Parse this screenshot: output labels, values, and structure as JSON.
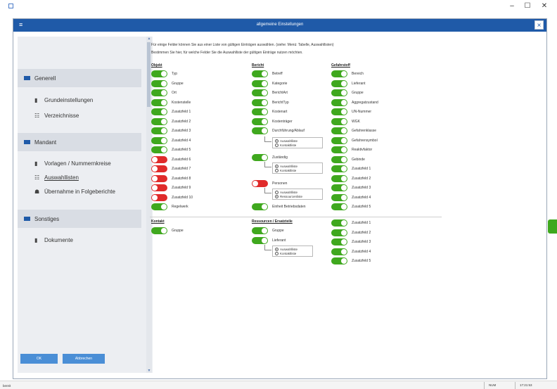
{
  "window": {
    "minimize": "–",
    "maximize": "☐",
    "close": "✕"
  },
  "dialog": {
    "title": "allgemeine Einstellungen",
    "menu_glyph": "≡",
    "close": "×"
  },
  "sidebar": {
    "groups": [
      {
        "label": "Generell",
        "items": [
          {
            "label": "Grundeinstellungen",
            "icon": "▮"
          },
          {
            "label": "Verzeichnisse",
            "icon": "☷"
          }
        ]
      },
      {
        "label": "Mandant",
        "items": [
          {
            "label": "Vorlagen / Nummernkreise",
            "icon": "▮"
          },
          {
            "label": "Auswahllisten",
            "icon": "☷"
          },
          {
            "label": "Übernahme in Folgeberichte",
            "icon": "☗"
          }
        ]
      },
      {
        "label": "Sonstiges",
        "items": [
          {
            "label": "Dokumente",
            "icon": "▮"
          }
        ]
      }
    ],
    "scroll_up": "▲",
    "scroll_down": "▼"
  },
  "buttons": {
    "ok": "OK",
    "cancel": "Abbrechen"
  },
  "intro": {
    "line1": "Für einige Felder können Sie aus einer Liste von gültigen Einträgen auswählen. (siehe: Menü: Tabelle, Auswahllisten)",
    "line2": "Bestimmen Sie hier, für welche Felder Sie die Auswahlliste der gültigen Einträge nutzen möchten."
  },
  "columns": {
    "objekt": {
      "head": "Objekt",
      "toggles": [
        {
          "label": "Typ",
          "on": true
        },
        {
          "label": "Gruppe",
          "on": true
        },
        {
          "label": "Ort",
          "on": true
        },
        {
          "label": "Kostenstelle",
          "on": true
        },
        {
          "label": "Zusatzfeld 1",
          "on": true
        },
        {
          "label": "Zusatzfeld 2",
          "on": true
        },
        {
          "label": "Zusatzfeld 3",
          "on": true
        },
        {
          "label": "Zusatzfeld 4",
          "on": true
        },
        {
          "label": "Zusatzfeld 5",
          "on": true
        },
        {
          "label": "Zusatzfeld 6",
          "on": false
        },
        {
          "label": "Zusatzfeld 7",
          "on": false
        },
        {
          "label": "Zusatzfeld 8",
          "on": false
        },
        {
          "label": "Zusatzfeld 9",
          "on": false
        },
        {
          "label": "Zusatzfeld 10",
          "on": false
        },
        {
          "label": "Regelwerk",
          "on": true
        }
      ]
    },
    "bericht": {
      "head": "Bericht",
      "toggles": [
        {
          "label": "Betreff",
          "on": true
        },
        {
          "label": "Kategorie",
          "on": true
        },
        {
          "label": "BerichtArt",
          "on": true
        },
        {
          "label": "BerichtTyp",
          "on": true
        },
        {
          "label": "Kostenart",
          "on": true
        },
        {
          "label": "Kostenträger",
          "on": true
        },
        {
          "label": "Durchführung/Ablauf",
          "on": true
        }
      ],
      "radio1": {
        "a": "Auswahlliste",
        "b": "Kontaktliste",
        "selected": "a"
      },
      "zustandig": {
        "label": "Zuständig",
        "on": true
      },
      "radio2": {
        "a": "Auswahlliste",
        "b": "Kontaktliste",
        "selected": "a"
      },
      "personen": {
        "label": "Personen",
        "on": false
      },
      "radio3": {
        "a": "Auswahlliste",
        "b": "Ressourcenliste",
        "selected": "b"
      },
      "einheit": {
        "label": "Einheit Betriebsdaten",
        "on": true
      }
    },
    "gefahrstoff": {
      "head": "Gefahrstoff",
      "toggles": [
        {
          "label": "Bereich",
          "on": true
        },
        {
          "label": "Lieferant",
          "on": true
        },
        {
          "label": "Gruppe",
          "on": true
        },
        {
          "label": "Aggregatzustand",
          "on": true
        },
        {
          "label": "UN-Nummer",
          "on": true
        },
        {
          "label": "WGK",
          "on": true
        },
        {
          "label": "Gefahrenklasse",
          "on": true
        },
        {
          "label": "Gefahrensymbol",
          "on": true
        },
        {
          "label": "Reaktivfaktor",
          "on": true
        },
        {
          "label": "Gebinde",
          "on": true
        },
        {
          "label": "Zusatzfeld 1",
          "on": true
        },
        {
          "label": "Zusatzfeld 2",
          "on": true
        },
        {
          "label": "Zusatzfeld 3",
          "on": true
        },
        {
          "label": "Zusatzfeld 4",
          "on": true
        },
        {
          "label": "Zusatzfeld 5",
          "on": true
        }
      ]
    },
    "kontakt": {
      "head": "Kontakt",
      "toggles": [
        {
          "label": "Gruppe",
          "on": true
        }
      ]
    },
    "ressourcen": {
      "head": "Ressourcen / Ersatzteile",
      "toggles": [
        {
          "label": "Gruppe",
          "on": true
        },
        {
          "label": "Lieferant",
          "on": true
        }
      ],
      "radio": {
        "a": "Auswahlliste",
        "b": "Kontaktliste",
        "selected": "a"
      }
    },
    "extra": {
      "toggles": [
        {
          "label": "Zusatzfeld 1",
          "on": true
        },
        {
          "label": "Zusatzfeld 2",
          "on": true
        },
        {
          "label": "Zusatzfeld 3",
          "on": true
        },
        {
          "label": "Zusatzfeld 4",
          "on": true
        },
        {
          "label": "Zusatzfeld 5",
          "on": true
        }
      ]
    }
  },
  "status": {
    "left": "bereit",
    "num": "NUM",
    "time": "17:21:53"
  },
  "colors": {
    "accent": "#1f5aa8",
    "on": "#3fa81e",
    "off": "#e02b2b",
    "button": "#4a8ed6"
  },
  "icons": {
    "app": "app-icon",
    "group": "folder-icon",
    "page": "page-icon",
    "list": "list-icon",
    "transfer": "transfer-icon"
  }
}
